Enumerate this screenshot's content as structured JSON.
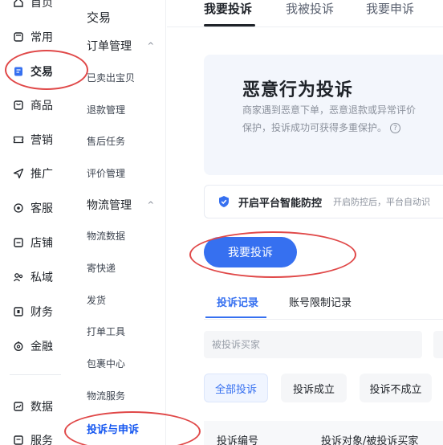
{
  "nav": {
    "items": [
      {
        "label": "首页",
        "icon": "home-icon"
      },
      {
        "label": "常用",
        "icon": "bookmark-icon"
      },
      {
        "label": "交易",
        "icon": "trade-icon"
      },
      {
        "label": "商品",
        "icon": "goods-icon"
      },
      {
        "label": "营销",
        "icon": "ticket-icon"
      },
      {
        "label": "推广",
        "icon": "send-icon"
      },
      {
        "label": "客服",
        "icon": "headset-icon"
      },
      {
        "label": "店铺",
        "icon": "shop-icon"
      },
      {
        "label": "私域",
        "icon": "users-icon"
      },
      {
        "label": "财务",
        "icon": "finance-icon"
      },
      {
        "label": "金融",
        "icon": "money-icon"
      },
      {
        "label": "数据",
        "icon": "chart-icon"
      },
      {
        "label": "服务",
        "icon": "service-icon"
      }
    ],
    "active": "交易"
  },
  "subnav": {
    "title": "交易",
    "groups": [
      {
        "label": "订单管理",
        "chevron": "^"
      },
      {
        "label": "物流管理",
        "chevron": "^"
      }
    ],
    "order_items": [
      "已卖出宝贝",
      "退款管理",
      "售后任务",
      "评价管理"
    ],
    "logistics_items": [
      "物流数据",
      "寄快递",
      "发货",
      "打单工具",
      "包裹中心",
      "物流服务"
    ],
    "active_item": "投诉与申诉"
  },
  "tabs": [
    "我要投诉",
    "我被投诉",
    "我要申诉"
  ],
  "hero": {
    "title": "恶意行为投诉",
    "desc_line1": "商家遇到恶意下单，恶意退款或异常评价",
    "desc_line2": "保护，投诉成功可获得多重保护。",
    "help_icon": "?"
  },
  "protect": {
    "title": "开启平台智能防控",
    "desc": "开启防控后，平台自动识"
  },
  "primary_button": "我要投诉",
  "subtabs": [
    "投诉记录",
    "账号限制记录"
  ],
  "search": {
    "placeholder": "被投诉买家"
  },
  "filters": [
    "全部投诉",
    "投诉成立",
    "投诉不成立"
  ],
  "table": {
    "headers": [
      "投诉编号",
      "投诉对象/被投诉买家"
    ]
  },
  "colors": {
    "accent": "#3670f0",
    "marker": "#e04848"
  }
}
